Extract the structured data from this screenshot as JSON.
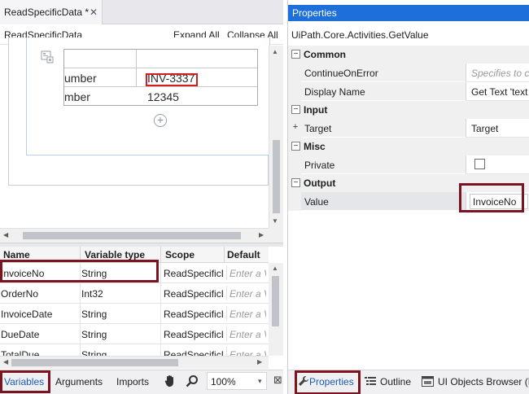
{
  "document": {
    "tab_title": "ReadSpecificData *",
    "breadcrumb": "ReadSpecificData",
    "expand_all": "Expand All",
    "collapse_all": "Collapse All",
    "table_rows": [
      {
        "label": "umber",
        "value": "INV-3337"
      },
      {
        "label": "mber",
        "value": "12345"
      }
    ],
    "add_activity_glyph": "+"
  },
  "variables": {
    "columns": [
      "Name",
      "Variable type",
      "Scope",
      "Default"
    ],
    "default_placeholder": "Enter a V",
    "rows": [
      {
        "name": "InvoiceNo",
        "type": "String",
        "scope": "ReadSpecificD"
      },
      {
        "name": "OrderNo",
        "type": "Int32",
        "scope": "ReadSpecificD"
      },
      {
        "name": "InvoiceDate",
        "type": "String",
        "scope": "ReadSpecificD"
      },
      {
        "name": "DueDate",
        "type": "String",
        "scope": "ReadSpecificD"
      },
      {
        "name": "TotalDue",
        "type": "String",
        "scope": "ReadSpecificD"
      }
    ]
  },
  "bottom_bar": {
    "variables": "Variables",
    "arguments": "Arguments",
    "imports": "Imports",
    "zoom": "100%"
  },
  "properties": {
    "title": "Properties",
    "class_name": "UiPath.Core.Activities.GetValue",
    "categories": {
      "common": "Common",
      "input": "Input",
      "misc": "Misc",
      "output": "Output"
    },
    "props": {
      "continue_on_error": {
        "name": "ContinueOnError",
        "placeholder": "Specifies to co"
      },
      "display_name": {
        "name": "Display Name",
        "value": "Get Text 'text"
      },
      "target": {
        "name": "Target",
        "value": "Target"
      },
      "private": {
        "name": "Private"
      },
      "value": {
        "name": "Value",
        "value": "InvoiceNo"
      }
    },
    "toggle_minus": "−",
    "toggle_plus": "+"
  },
  "right_bottom": {
    "properties": "Properties",
    "outline": "Outline",
    "ui_objects": "UI Objects Browser (E"
  },
  "colors": {
    "title_bar": "#1e6fd9",
    "highlight": "#7b1420",
    "selector_highlight": "#d41e1e",
    "active_tab_text": "#1a5cb8"
  }
}
